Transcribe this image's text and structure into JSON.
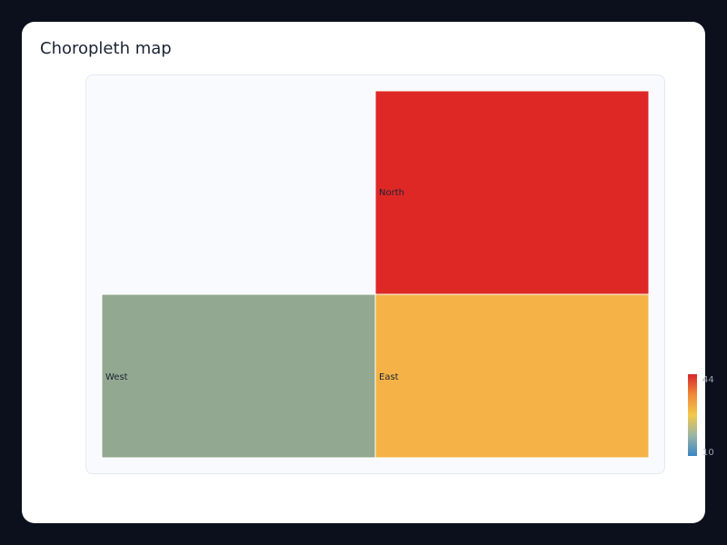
{
  "card": {
    "title": "Choropleth map"
  },
  "chart_data": {
    "type": "choropleth",
    "title": "Choropleth map",
    "regions": [
      {
        "name": "North",
        "value": 44,
        "color": "#de2826"
      },
      {
        "name": "West",
        "value": 10,
        "color": "#92a890"
      },
      {
        "name": "East",
        "value": 33,
        "color": "#f5b347"
      }
    ],
    "colorscale": {
      "min": 10,
      "max": 44,
      "stops": [
        {
          "offset": 0.0,
          "color": "#3b86c4"
        },
        {
          "offset": 0.25,
          "color": "#9ab5a6"
        },
        {
          "offset": 0.5,
          "color": "#f2c94a"
        },
        {
          "offset": 0.75,
          "color": "#f08a37"
        },
        {
          "offset": 1.0,
          "color": "#d7262b"
        }
      ],
      "tick_labels": [
        "44",
        "10"
      ]
    }
  }
}
